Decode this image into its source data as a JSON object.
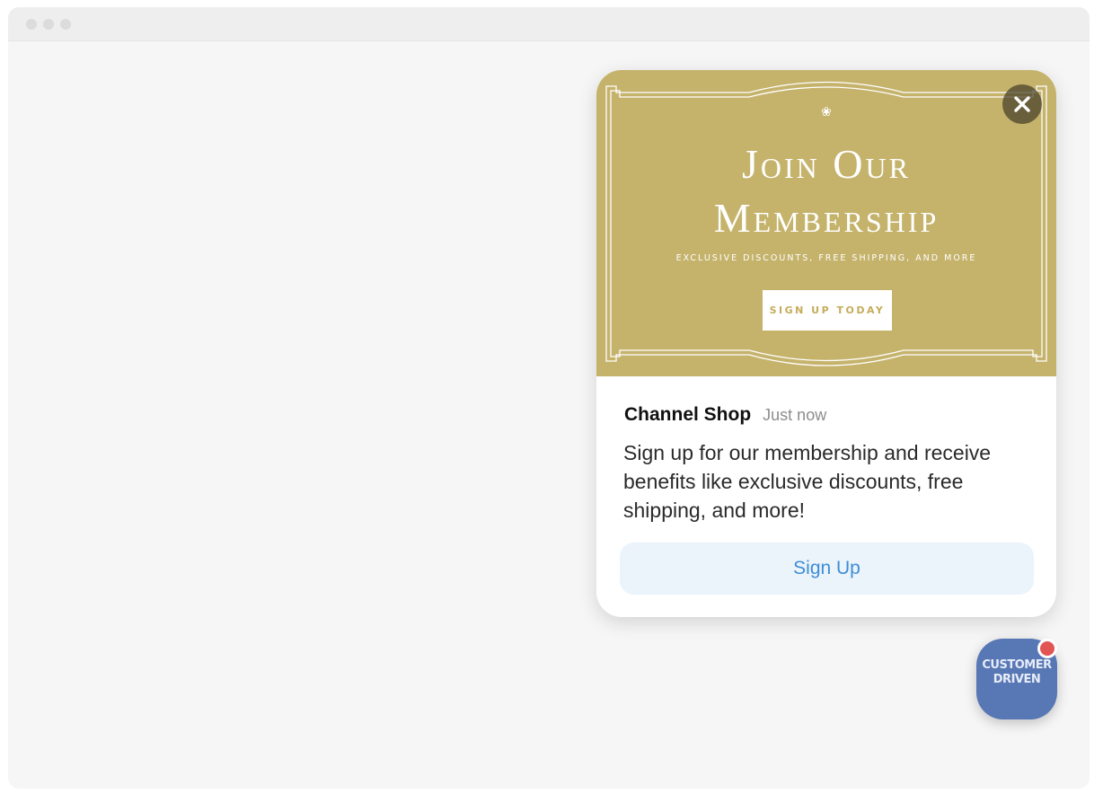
{
  "window": {
    "controls": [
      "dot",
      "dot",
      "dot"
    ]
  },
  "popup": {
    "banner": {
      "title_line1": "Join Our",
      "title_line2": "Membership",
      "subtitle": "EXCLUSIVE DISCOUNTS, FREE SHIPPING, AND MORE",
      "cta_label": "SIGN UP TODAY",
      "background_color": "#c5b36c",
      "ornament_icon": "sprig-icon"
    },
    "close_icon": "close-icon",
    "sender": "Channel Shop",
    "time": "Just now",
    "message": "Sign up for our membership and receive benefits like exclusive discounts, free shipping, and more!",
    "action_label": "Sign Up",
    "action_text_color": "#3d8ed6",
    "action_bg_color": "#ebf3fb"
  },
  "launcher": {
    "logo_text_line1": "CUSTOMER",
    "logo_text_line2": "DRIVEN",
    "background_color": "#5877b5",
    "badge_color": "#e25555"
  }
}
